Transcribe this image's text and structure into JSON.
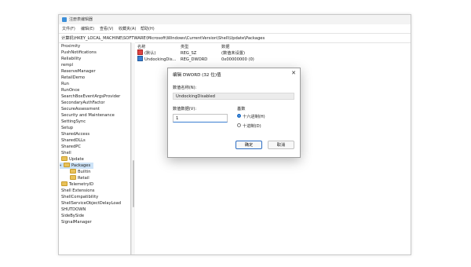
{
  "window": {
    "title": "注册表编辑器",
    "menu": [
      "文件(F)",
      "编辑(E)",
      "查看(V)",
      "收藏夹(A)",
      "帮助(H)"
    ],
    "address": "计算机\\HKEY_LOCAL_MACHINE\\SOFTWARE\\Microsoft\\Windows\\CurrentVersion\\Shell\\Update\\Packages"
  },
  "tree": {
    "items": [
      {
        "label": "Proximity"
      },
      {
        "label": "PushNotifications"
      },
      {
        "label": "Reliability"
      },
      {
        "label": "rempl"
      },
      {
        "label": "ReserveManager"
      },
      {
        "label": "RetailDemo"
      },
      {
        "label": "Run"
      },
      {
        "label": "RunOnce"
      },
      {
        "label": "SearchBoxEventArgsProvider"
      },
      {
        "label": "SecondaryAuthFactor"
      },
      {
        "label": "SecureAssessment"
      },
      {
        "label": "Security and Maintenance"
      },
      {
        "label": "SettingSync"
      },
      {
        "label": "Setup"
      },
      {
        "label": "SharedAccess"
      },
      {
        "label": "SharedDLLs"
      },
      {
        "label": "SharedPC"
      },
      {
        "label": "Shell"
      },
      {
        "label": "Update"
      },
      {
        "label": "Packages"
      },
      {
        "label": "Builtin"
      },
      {
        "label": "Retail"
      },
      {
        "label": "TelemetryID"
      },
      {
        "label": "Shell Extensions"
      },
      {
        "label": "ShellCompatibility"
      },
      {
        "label": "ShellServiceObjectDelayLoad"
      },
      {
        "label": "SHUTDOWN"
      },
      {
        "label": "SideBySide"
      },
      {
        "label": "SignalManager"
      }
    ]
  },
  "values": {
    "headers": {
      "name": "名称",
      "type": "类型",
      "data": "数据"
    },
    "rows": [
      {
        "name": "(默认)",
        "type": "REG_SZ",
        "data": "(数值未设置)",
        "icon": "string-value-icon"
      },
      {
        "name": "UndockingDis...",
        "type": "REG_DWORD",
        "data": "0x00000000 (0)",
        "icon": "dword-value-icon"
      }
    ]
  },
  "dialog": {
    "title": "编辑 DWORD (32 位)值",
    "close": "✕",
    "name_label": "数值名称(N):",
    "name_value": "UndockingDisabled",
    "data_label": "数值数据(V):",
    "data_value": "1",
    "base_label": "基数",
    "radio_hex": "十六进制(H)",
    "radio_dec": "十进制(D)",
    "selected_base": "hex",
    "ok": "确定",
    "cancel": "取消"
  }
}
